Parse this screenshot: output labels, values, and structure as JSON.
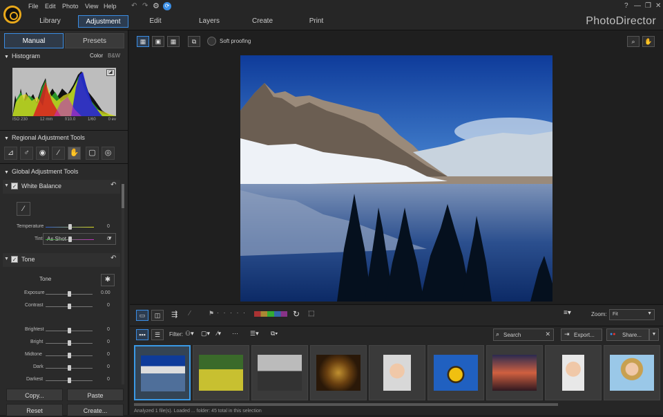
{
  "menu": {
    "file": "File",
    "edit": "Edit",
    "photo": "Photo",
    "view": "View",
    "help": "Help"
  },
  "tabs": {
    "library": "Library",
    "adjustment": "Adjustment",
    "edit": "Edit",
    "layers": "Layers",
    "create": "Create",
    "print": "Print"
  },
  "app_name": "PhotoDirector",
  "window": {
    "help": "?",
    "minimize": "—",
    "restore": "❐",
    "close": "✕"
  },
  "left": {
    "tab_manual": "Manual",
    "tab_presets": "Presets",
    "histogram": {
      "title": "Histogram",
      "color": "Color",
      "bw": "B&W",
      "info": [
        "ISO 230",
        "12 mm",
        "f/10.0",
        "1/60",
        "0 ev"
      ]
    },
    "regional": "Regional Adjustment Tools",
    "global": "Global Adjustment Tools",
    "wb": {
      "title": "White Balance",
      "preset": "As Shot",
      "temperature": "Temperature",
      "temperature_val": "0",
      "tint": "Tint",
      "tint_val": "0"
    },
    "tone": {
      "title": "Tone",
      "sub": "Tone",
      "exposure": "Exposure",
      "exposure_val": "0.00",
      "contrast": "Contrast",
      "contrast_val": "0",
      "brightest": "Brightest",
      "brightest_val": "0",
      "bright": "Bright",
      "bright_val": "0",
      "midtone": "Midtone",
      "midtone_val": "0",
      "dark": "Dark",
      "dark_val": "0",
      "darkest": "Darkest",
      "darkest_val": "0"
    },
    "copy": "Copy...",
    "paste": "Paste",
    "reset": "Reset",
    "create": "Create..."
  },
  "viewer": {
    "soft_proofing": "Soft proofing"
  },
  "film": {
    "zoom_label": "Zoom:",
    "zoom_value": "Fit",
    "filter": "Filter:",
    "search_placeholder": "Search",
    "export": "Export...",
    "share": "Share...",
    "status": "Analyzed 1 file(s). Loaded ... folder: 45 total in this selection"
  },
  "colors": {
    "accent": "#3a9ae6",
    "logo": "#e8a81a"
  }
}
